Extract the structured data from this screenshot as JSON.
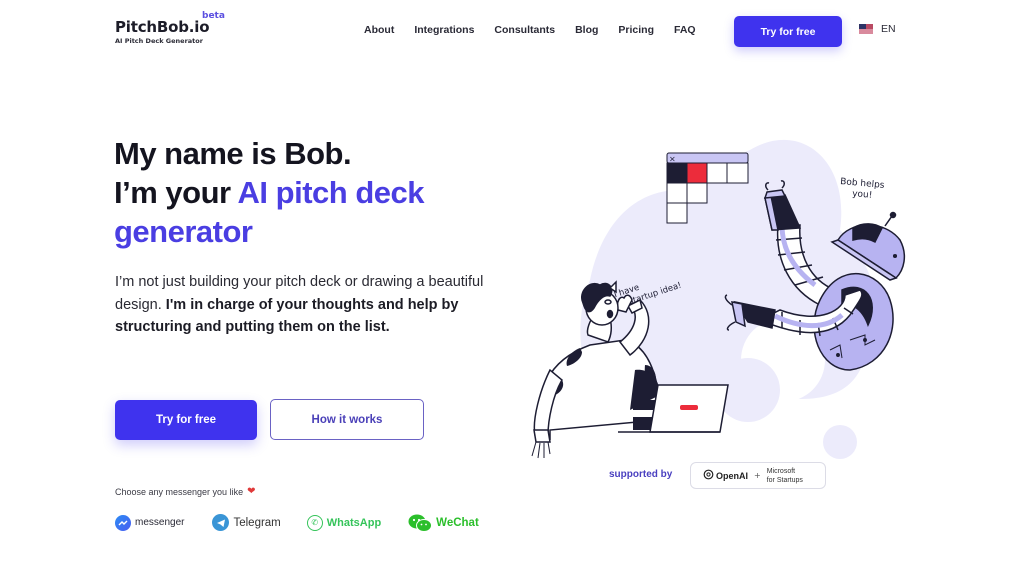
{
  "header": {
    "logo_name": "PitchBob.io",
    "logo_badge": "beta",
    "logo_tagline": "AI Pitch Deck Generator",
    "nav": [
      {
        "label": "About"
      },
      {
        "label": "Integrations"
      },
      {
        "label": "Consultants"
      },
      {
        "label": "Blog"
      },
      {
        "label": "Pricing"
      },
      {
        "label": "FAQ"
      }
    ],
    "cta_label": "Try for free",
    "language": {
      "flag": "us-flag-icon",
      "label": "EN"
    }
  },
  "hero": {
    "title_line1": "My name is Bob.",
    "title_line2_prefix": "I’m your ",
    "title_accent": "AI pitch deck generator",
    "desc_plain": "I’m not just building your pitch deck or drawing a beautiful design. ",
    "desc_bold": "I'm in charge of your thoughts and help by structuring and putting them on the list.",
    "primary_button": "Try for free",
    "secondary_button": "How it works",
    "accent_color": "#4a3ee2",
    "button_color": "#3f33ee"
  },
  "messengers": {
    "label": "Choose any messenger you like",
    "label_icon": "heart-icon",
    "items": [
      {
        "label": "messenger",
        "icon": "facebook-messenger-icon"
      },
      {
        "label": "Telegram",
        "icon": "telegram-icon"
      },
      {
        "label": "WhatsApp",
        "icon": "whatsapp-icon"
      },
      {
        "label": "WeChat",
        "icon": "wechat-icon"
      }
    ]
  },
  "illustration": {
    "person_speech": "I have a startup idea!",
    "robot_speech": "Bob helps you!"
  },
  "supporters": {
    "label": "supported by",
    "openai": "OpenAI",
    "plus": "+",
    "microsoft_line1": "Microsoft",
    "microsoft_line2": "for Startups"
  }
}
